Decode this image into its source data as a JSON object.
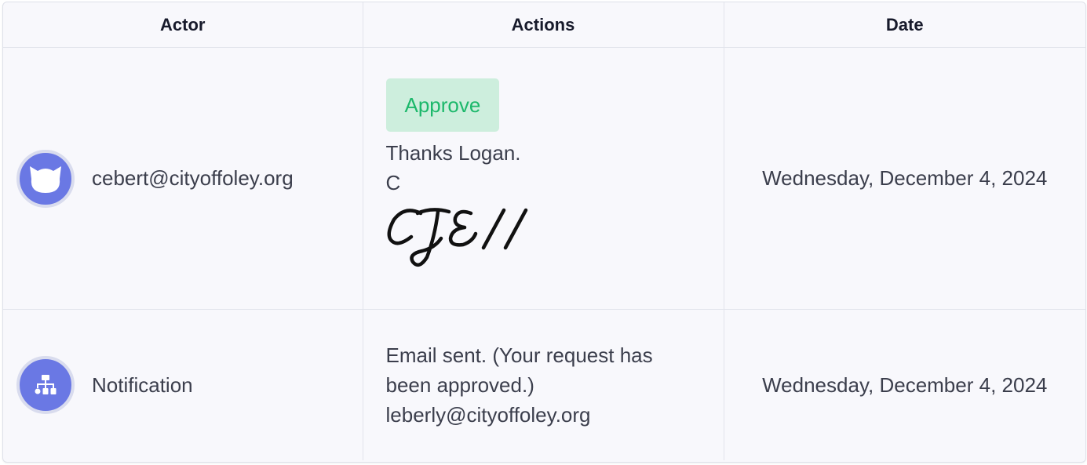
{
  "table": {
    "headers": {
      "actor": "Actor",
      "actions": "Actions",
      "date": "Date"
    },
    "rows": [
      {
        "actor_icon": "user-avatar-icon",
        "actor": "cebert@cityoffoley.org",
        "action_badge": "Approve",
        "comment_lines": [
          "Thanks Logan.",
          "C"
        ],
        "signature": "CJE//",
        "date": "Wednesday, December 4, 2024"
      },
      {
        "actor_icon": "workflow-icon",
        "actor": "Notification",
        "comment_lines": [
          "Email sent. (Your request has",
          "been approved.)",
          "leberly@cityoffoley.org"
        ],
        "date": "Wednesday, December 4, 2024"
      }
    ]
  },
  "colors": {
    "avatar": "#6a78e4",
    "approve_bg": "#cdeedd",
    "approve_text": "#1cb86b"
  }
}
